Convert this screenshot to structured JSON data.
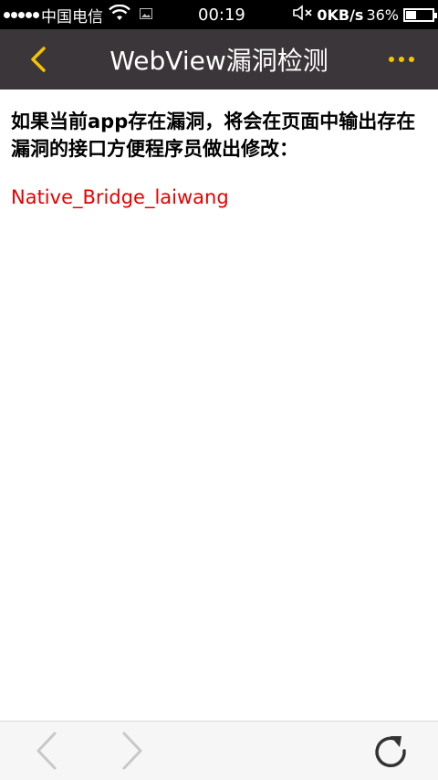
{
  "status_bar": {
    "carrier": "中国电信",
    "time": "00:19",
    "net_speed": "0KB/s",
    "battery_percent": "36%",
    "battery_level": 0.36
  },
  "header": {
    "title": "WebView漏洞检测",
    "back_icon": "chevron-left-icon",
    "more_icon": "more-dots-icon",
    "accent_color": "#f5c400",
    "background_color": "#3a3639"
  },
  "main": {
    "info_text": "如果当前app存在漏洞，将会在页面中输出存在漏洞的接口方便程序员做出修改：",
    "result_text": "Native_Bridge_laiwang",
    "result_color": "#e60000"
  },
  "toolbar": {
    "back_icon": "arrow-back-icon",
    "forward_icon": "arrow-forward-icon",
    "refresh_icon": "refresh-icon"
  }
}
